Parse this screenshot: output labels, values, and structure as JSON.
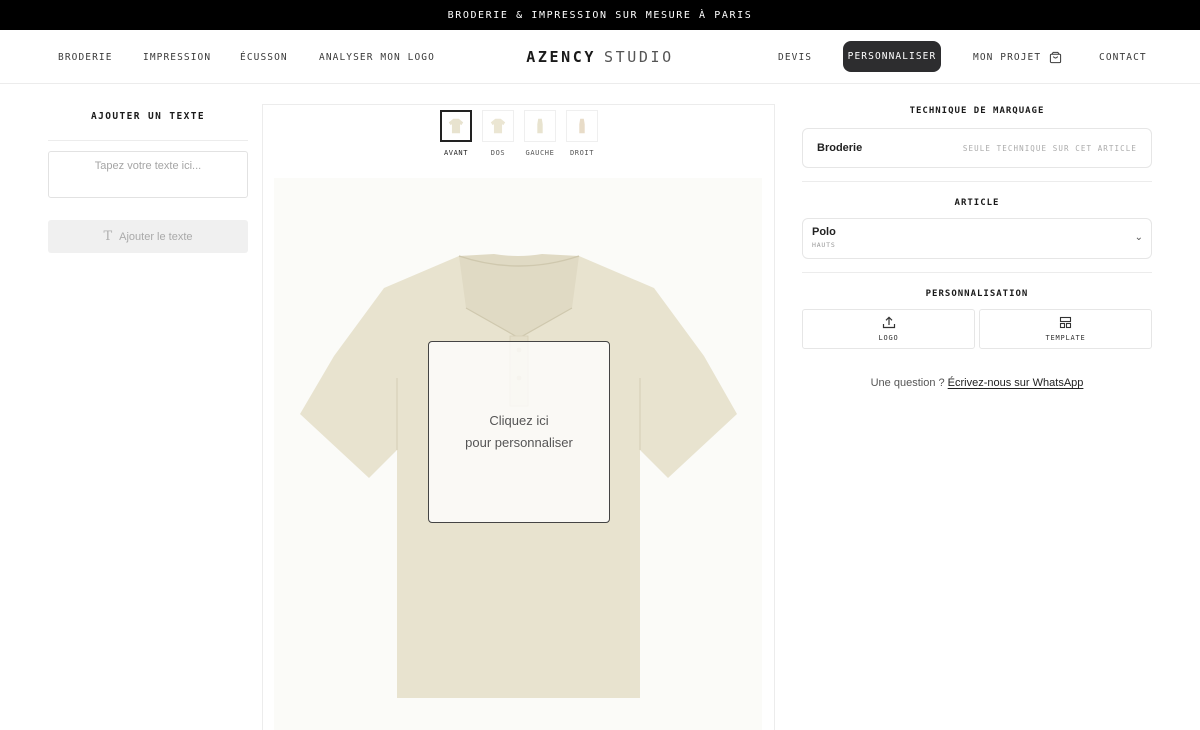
{
  "banner": {
    "text": "BRODERIE & IMPRESSION SUR MESURE À PARIS"
  },
  "nav": {
    "left_links": [
      "BRODERIE",
      "IMPRESSION",
      "ÉCUSSON",
      "ANALYSER MON LOGO"
    ],
    "logo_bold": "AZENCY",
    "logo_light": "STUDIO",
    "devis": "DEVIS",
    "personnaliser": "PERSONNALISER",
    "mon_projet": "MON PROJET",
    "contact": "CONTACT"
  },
  "left_panel": {
    "title": "AJOUTER UN TEXTE",
    "text_placeholder": "Tapez votre texte ici...",
    "text_value": "",
    "add_button": "Ajouter le texte"
  },
  "views": [
    "AVANT",
    "DOS",
    "GAUCHE",
    "DROIT"
  ],
  "active_view": "AVANT",
  "canvas": {
    "zone_line1": "Cliquez ici",
    "zone_line2": "pour personnaliser",
    "shirt_color": "#e8e3cf"
  },
  "right_panel": {
    "technique_title": "TECHNIQUE DE MARQUAGE",
    "technique_name": "Broderie",
    "technique_note": "SEULE TECHNIQUE SUR CET ARTICLE",
    "article_title": "ARTICLE",
    "article_name": "Polo",
    "article_category": "HAUTS",
    "perso_title": "PERSONNALISATION",
    "logo_label": "LOGO",
    "template_label": "TEMPLATE",
    "question_text": "Une question ?",
    "whatsapp_link": "Écrivez-nous sur WhatsApp"
  },
  "colors": {
    "banner_bg": "#000000",
    "active_pill": "#2d2d2f",
    "shirt": "#e8e3cf"
  }
}
